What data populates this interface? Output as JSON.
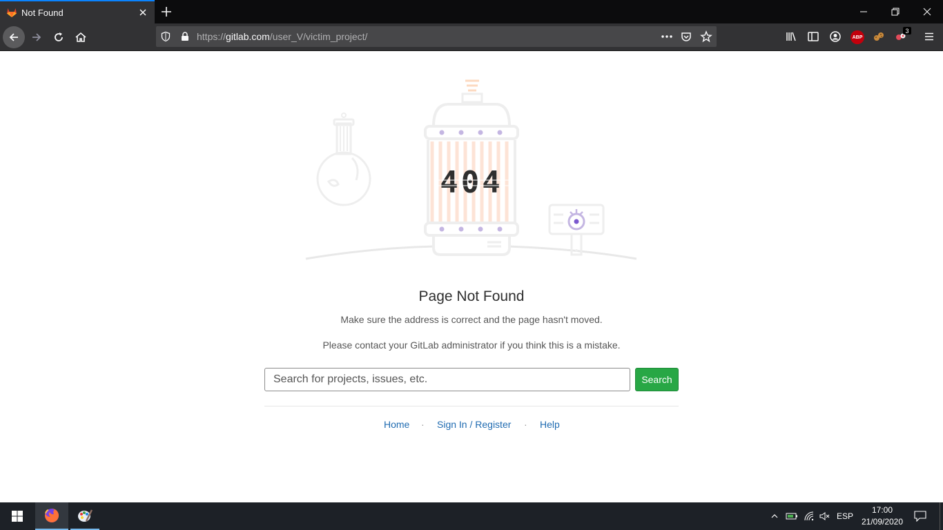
{
  "browser": {
    "tab": {
      "title": "Not Found",
      "favicon": "gitlab-icon"
    },
    "url": {
      "prefix": "https://",
      "host": "gitlab.com",
      "path": "/user_V/victim_project/"
    },
    "addons": {
      "abp_label": "ABP",
      "badge_count": "3"
    }
  },
  "page": {
    "illustration": {
      "code": "404"
    },
    "title": "Page Not Found",
    "message1": "Make sure the address is correct and the page hasn't moved.",
    "message2": "Please contact your GitLab administrator if you think this is a mistake.",
    "search": {
      "placeholder": "Search for projects, issues, etc.",
      "button_label": "Search"
    },
    "links": {
      "home": "Home",
      "signin": "Sign In / Register",
      "help": "Help",
      "separator": "·"
    }
  },
  "taskbar": {
    "language": "ESP",
    "time": "17:00",
    "date": "21/09/2020"
  }
}
